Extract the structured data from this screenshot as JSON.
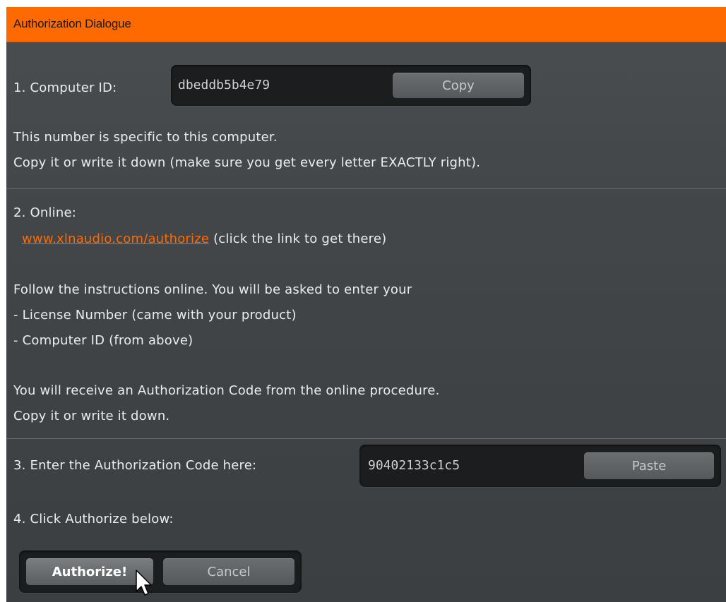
{
  "window": {
    "title": "Authorization Dialogue"
  },
  "step1": {
    "label": "1. Computer ID:",
    "computer_id": "dbeddb5b4e79",
    "copy_button": "Copy",
    "note_line1": "This number is specific to this computer.",
    "note_line2": "Copy it or write it down (make sure you get every letter EXACTLY right)."
  },
  "step2": {
    "label": "2. Online:",
    "link": "www.xlnaudio.com/authorize",
    "link_hint": "(click the link to get there)",
    "instructions": "Follow the instructions online. You will be asked to enter your",
    "item1": "- License Number (came with your product)",
    "item2": "- Computer ID (from above)",
    "receive": "You will receive an Authorization Code from the online procedure.",
    "receive2": "Copy it or write it down."
  },
  "step3": {
    "label": "3. Enter the Authorization Code here:",
    "auth_code": "90402133c1c5",
    "paste_button": "Paste"
  },
  "step4": {
    "label": "4. Click Authorize below:",
    "authorize_button": "Authorize!",
    "cancel_button": "Cancel"
  },
  "colors": {
    "accent": "#ff6a00",
    "panel": "#434749",
    "well": "#1c1d1e"
  }
}
